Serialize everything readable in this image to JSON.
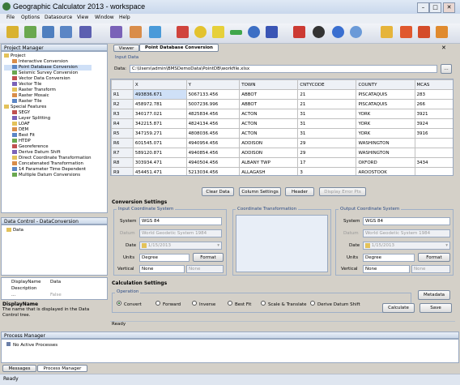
{
  "window": {
    "title": "Geographic Calculator 2013 - workspace"
  },
  "menu": [
    "File",
    "Options",
    "Datasource",
    "View",
    "Window",
    "Help"
  ],
  "project_manager": {
    "title": "Project Manager",
    "items": [
      {
        "label": "Project",
        "level": 0
      },
      {
        "label": "Interactive Conversion",
        "level": 2
      },
      {
        "label": "Point Database Conversion",
        "level": 2
      },
      {
        "label": "Seismic Survey Conversion",
        "level": 2
      },
      {
        "label": "Vector Data Conversion",
        "level": 2
      },
      {
        "label": "Vector Tile",
        "level": 2
      },
      {
        "label": "Raster Transform",
        "level": 2
      },
      {
        "label": "Raster Mosaic",
        "level": 2
      },
      {
        "label": "Raster Tile",
        "level": 2
      },
      {
        "label": "Special Features",
        "level": 0
      },
      {
        "label": "SEGY",
        "level": 2
      },
      {
        "label": "Layer Splitting",
        "level": 2
      },
      {
        "label": "LOAF",
        "level": 2
      },
      {
        "label": "DEM",
        "level": 2
      },
      {
        "label": "Best Fit",
        "level": 2
      },
      {
        "label": "HTDP",
        "level": 2
      },
      {
        "label": "Georeference",
        "level": 2
      },
      {
        "label": "Derive Datum Shift",
        "level": 2
      },
      {
        "label": "Direct Coordinate Transformation",
        "level": 2
      },
      {
        "label": "Concatenated Transformation",
        "level": 2
      },
      {
        "label": "14 Parameter Time Dependent",
        "level": 2
      },
      {
        "label": "Multiple Datum Conversions",
        "level": 2
      }
    ]
  },
  "data_control": {
    "title": "Data Control - DataConversion",
    "items": [
      {
        "label": "Data"
      }
    ],
    "prop_name_label": "DisplayName",
    "prop_name_value": "Data",
    "prop_desc_label": "Description",
    "prop_row3_label": "...",
    "prop_row3_value": "False",
    "help_title": "DisplayName",
    "help_text": "The name that is displayed in the Data Control tree."
  },
  "tabs": [
    {
      "label": "Viewer"
    },
    {
      "label": "Point Database Conversion"
    }
  ],
  "input_data": {
    "title": "Input Data",
    "data_label": "Data:",
    "data_path": "C:\\Users\\admin\\BMSDemoData\\PointDB\\workfile.xlsx",
    "columns": [
      "",
      "X",
      "Y",
      "TOWN",
      "CNTYCODE",
      "COUNTY",
      "MCAS"
    ],
    "rows": [
      [
        "R1",
        "493836.671",
        "5067133.456",
        "ABBOT",
        "21",
        "PISCATAQUIS",
        "283"
      ],
      [
        "R2",
        "458972.781",
        "5007236.996",
        "ABBOT",
        "21",
        "PISCATAQUIS",
        "266"
      ],
      [
        "R3",
        "340177.021",
        "4825834.456",
        "ACTON",
        "31",
        "YORK",
        "3921"
      ],
      [
        "R4",
        "342215.871",
        "4824134.456",
        "ACTON",
        "31",
        "YORK",
        "3924"
      ],
      [
        "R5",
        "347159.271",
        "4808036.456",
        "ACTON",
        "31",
        "YORK",
        "3916"
      ],
      [
        "R6",
        "601545.071",
        "4940954.456",
        "ADDISON",
        "29",
        "WASHINGTON",
        ""
      ],
      [
        "R7",
        "589120.871",
        "4940854.456",
        "ADDISON",
        "29",
        "WASHINGTON",
        ""
      ],
      [
        "R8",
        "303934.471",
        "4940504.456",
        "ALBANY TWP",
        "17",
        "OXFORD",
        "3434"
      ],
      [
        "R9",
        "454451.471",
        "5213034.456",
        "ALLAGASH",
        "3",
        "AROOSTOOK",
        ""
      ]
    ],
    "buttons": [
      "Clear Data",
      "Column Settings",
      "Header",
      "Display Error Pts"
    ]
  },
  "conversion": {
    "title": "Conversion Settings",
    "input_title": "Input Coordinate System",
    "direct_title": "Coordinate Transformation",
    "output_title": "Output Coordinate System",
    "system_label": "System",
    "datum_label": "Datum",
    "date_label": "Date",
    "units_label": "Units",
    "vertical_label": "Vertical",
    "input": {
      "system": "WGS 84",
      "datum": "World Geodetic System 1984",
      "date": "1/15/2013",
      "units": "Degree",
      "vertical": "None",
      "vertical2": "None",
      "format": "Format"
    },
    "output": {
      "system": "WGS 84",
      "datum": "World Geodetic System 1984",
      "date": "1/15/2013",
      "units": "Degree",
      "vertical": "None",
      "vertical2": "None",
      "format": "Format"
    }
  },
  "calculation": {
    "title": "Calculation Settings",
    "operation_label": "Operation",
    "options": [
      "Convert",
      "Forward",
      "Inverse",
      "Best Fit",
      "Scale & Translate",
      "Derive Datum Shift"
    ],
    "selected": 0,
    "metadata_btn": "Metadata",
    "calculate_btn": "Calculate",
    "save_btn": "Save"
  },
  "status_inner": "Ready",
  "process_manager": {
    "title": "Process Manager",
    "text": "No Active Processes"
  },
  "bottom_tabs": [
    "Messages",
    "Process Manager"
  ],
  "status": "Ready"
}
